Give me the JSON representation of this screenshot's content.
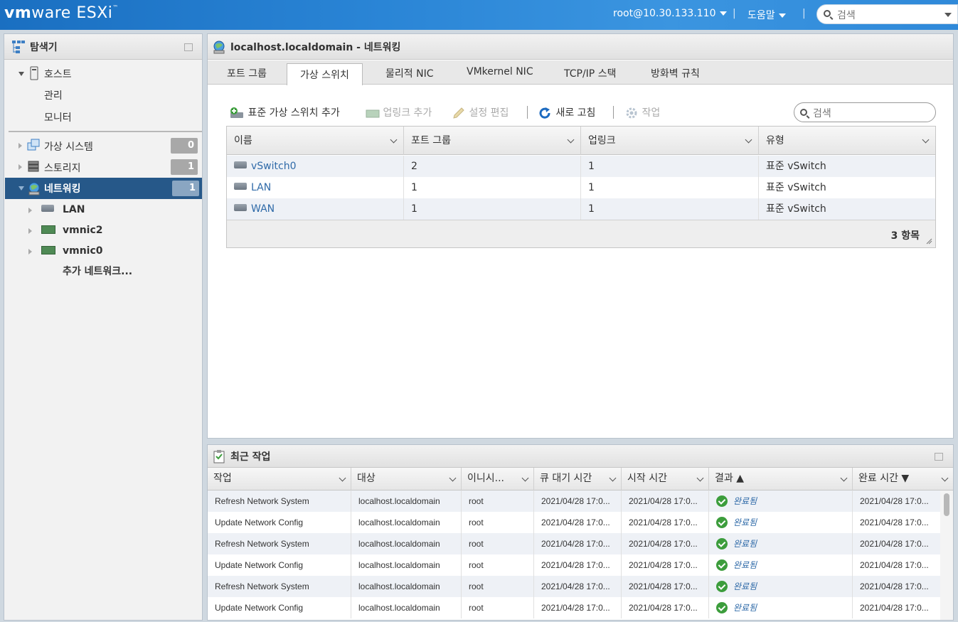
{
  "header": {
    "brand_vm": "vm",
    "brand_ware": "ware",
    "brand_product": "ESXi",
    "brand_tm": "™",
    "user": "root@10.30.133.110",
    "help": "도움말",
    "search_placeholder": "검색"
  },
  "navigator": {
    "title": "탐색기",
    "host_label": "호스트",
    "host_children": [
      "관리",
      "모니터"
    ],
    "items": [
      {
        "label": "가상 시스템",
        "count": "0"
      },
      {
        "label": "스토리지",
        "count": "1"
      },
      {
        "label": "네트워킹",
        "count": "1"
      }
    ],
    "network_children": [
      "LAN",
      "vmnic2",
      "vmnic0"
    ],
    "more_networks": "추가 네트워크..."
  },
  "main": {
    "title": "localhost.localdomain - 네트워킹",
    "tabs": [
      "포트 그룹",
      "가상 스위치",
      "물리적 NIC",
      "VMkernel NIC",
      "TCP/IP 스택",
      "방화벽 규칙"
    ],
    "active_tab": "가상 스위치",
    "toolbar": {
      "add_switch": "표준 가상 스위치 추가",
      "add_uplink": "업링크 추가",
      "edit_settings": "설정 편집",
      "refresh": "새로 고침",
      "actions": "작업"
    },
    "search_placeholder": "검색",
    "columns": [
      "이름",
      "포트 그룹",
      "업링크",
      "유형"
    ],
    "rows": [
      {
        "name": "vSwitch0",
        "port_groups": "2",
        "uplinks": "1",
        "type": "표준 vSwitch"
      },
      {
        "name": "LAN",
        "port_groups": "1",
        "uplinks": "1",
        "type": "표준 vSwitch"
      },
      {
        "name": "WAN",
        "port_groups": "1",
        "uplinks": "1",
        "type": "표준 vSwitch"
      }
    ],
    "item_count": "3 항목"
  },
  "tasks": {
    "title": "최근 작업",
    "columns": [
      "작업",
      "대상",
      "이니시...",
      "큐 대기 시간",
      "시작 시간",
      "결과 ▲",
      "완료 시간 ▼"
    ],
    "rows": [
      {
        "task": "Refresh Network System",
        "target": "localhost.localdomain",
        "initiator": "root",
        "queued": "2021/04/28 17:0...",
        "started": "2021/04/28 17:0...",
        "result": "완료됨",
        "completed": "2021/04/28 17:0..."
      },
      {
        "task": "Update Network Config",
        "target": "localhost.localdomain",
        "initiator": "root",
        "queued": "2021/04/28 17:0...",
        "started": "2021/04/28 17:0...",
        "result": "완료됨",
        "completed": "2021/04/28 17:0..."
      },
      {
        "task": "Refresh Network System",
        "target": "localhost.localdomain",
        "initiator": "root",
        "queued": "2021/04/28 17:0...",
        "started": "2021/04/28 17:0...",
        "result": "완료됨",
        "completed": "2021/04/28 17:0..."
      },
      {
        "task": "Update Network Config",
        "target": "localhost.localdomain",
        "initiator": "root",
        "queued": "2021/04/28 17:0...",
        "started": "2021/04/28 17:0...",
        "result": "완료됨",
        "completed": "2021/04/28 17:0..."
      },
      {
        "task": "Refresh Network System",
        "target": "localhost.localdomain",
        "initiator": "root",
        "queued": "2021/04/28 17:0...",
        "started": "2021/04/28 17:0...",
        "result": "완료됨",
        "completed": "2021/04/28 17:0..."
      },
      {
        "task": "Update Network Config",
        "target": "localhost.localdomain",
        "initiator": "root",
        "queued": "2021/04/28 17:0...",
        "started": "2021/04/28 17:0...",
        "result": "완료됨",
        "completed": "2021/04/28 17:0..."
      }
    ]
  },
  "colors": {
    "header_blue": "#2a85d6",
    "selected_nav": "#265889",
    "link": "#2f6aa8",
    "success": "#3c9d3c"
  }
}
